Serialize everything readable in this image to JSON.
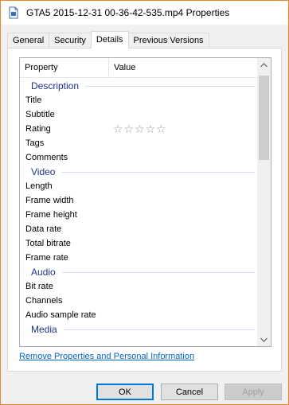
{
  "window": {
    "title": "GTA5 2015-12-31 00-36-42-535.mp4 Properties",
    "icon": "document-icon"
  },
  "tabs": [
    {
      "label": "General",
      "active": false
    },
    {
      "label": "Security",
      "active": false
    },
    {
      "label": "Details",
      "active": true
    },
    {
      "label": "Previous Versions",
      "active": false
    }
  ],
  "list": {
    "header_property": "Property",
    "header_value": "Value",
    "groups": {
      "description": {
        "label": "Description",
        "rows": [
          {
            "name": "Title",
            "value": ""
          },
          {
            "name": "Subtitle",
            "value": ""
          },
          {
            "name": "Rating",
            "value": "☆☆☆☆☆"
          },
          {
            "name": "Tags",
            "value": ""
          },
          {
            "name": "Comments",
            "value": ""
          }
        ]
      },
      "video": {
        "label": "Video",
        "rows": [
          {
            "name": "Length",
            "value": ""
          },
          {
            "name": "Frame width",
            "value": ""
          },
          {
            "name": "Frame height",
            "value": ""
          },
          {
            "name": "Data rate",
            "value": ""
          },
          {
            "name": "Total bitrate",
            "value": ""
          },
          {
            "name": "Frame rate",
            "value": ""
          }
        ]
      },
      "audio": {
        "label": "Audio",
        "rows": [
          {
            "name": "Bit rate",
            "value": ""
          },
          {
            "name": "Channels",
            "value": ""
          },
          {
            "name": "Audio sample rate",
            "value": ""
          }
        ]
      },
      "media": {
        "label": "Media"
      }
    }
  },
  "link": {
    "label": "Remove Properties and Personal Information"
  },
  "buttons": {
    "ok": "OK",
    "cancel": "Cancel",
    "apply": "Apply"
  },
  "colors": {
    "accent": "#0078d7",
    "group_heading": "#1e3287",
    "link": "#0066cc",
    "window_border": "#e6872a"
  }
}
